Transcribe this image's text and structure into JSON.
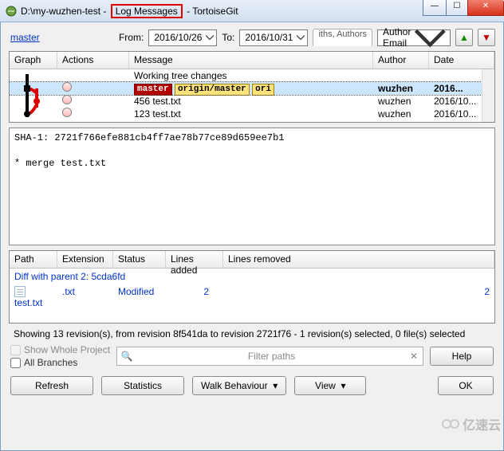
{
  "window": {
    "title_pre": "D:\\my-wuzhen-test -",
    "title_hl": "Log Messages",
    "title_post": "- TortoiseGit"
  },
  "filter": {
    "branch": "master",
    "from_label": "From:",
    "from_date": "2016/10/26",
    "to_label": "To:",
    "to_date": "2016/10/31",
    "tab_label": "iths, Authors",
    "combo_value": "Author Email"
  },
  "commits": {
    "headers": {
      "graph": "Graph",
      "actions": "Actions",
      "message": "Message",
      "author": "Author",
      "date": "Date"
    },
    "rows": [
      {
        "message": "Working tree changes",
        "author": "",
        "date": "",
        "selected": false,
        "refs": []
      },
      {
        "message": "",
        "author": "wuzhen",
        "date": "2016...",
        "selected": true,
        "refs": [
          "master",
          "origin/master",
          "ori"
        ]
      },
      {
        "message": "456 test.txt",
        "author": "wuzhen",
        "date": "2016/10...",
        "selected": false,
        "refs": []
      },
      {
        "message": "123 test.txt",
        "author": "wuzhen",
        "date": "2016/10...",
        "selected": false,
        "refs": []
      }
    ]
  },
  "details": {
    "sha_label": "SHA-1:",
    "sha": "2721f766efe881cb4ff7ae78b77ce89d659ee7b1",
    "body": "* merge test.txt"
  },
  "files": {
    "headers": {
      "path": "Path",
      "ext": "Extension",
      "status": "Status",
      "added": "Lines added",
      "removed": "Lines removed"
    },
    "diff_header": "Diff with parent 2: 5cda6fd",
    "rows": [
      {
        "path": "test.txt",
        "ext": ".txt",
        "status": "Modified",
        "added": "2",
        "removed": "2"
      }
    ]
  },
  "status": "Showing 13 revision(s), from revision 8f541da to revision 2721f76 - 1 revision(s) selected, 0 file(s) selected",
  "options": {
    "show_whole_project": "Show Whole Project",
    "all_branches": "All Branches",
    "filter_placeholder": "Filter paths"
  },
  "buttons": {
    "help": "Help",
    "refresh": "Refresh",
    "statistics": "Statistics",
    "walk": "Walk Behaviour",
    "view": "View",
    "ok": "OK"
  },
  "watermark": "亿速云"
}
